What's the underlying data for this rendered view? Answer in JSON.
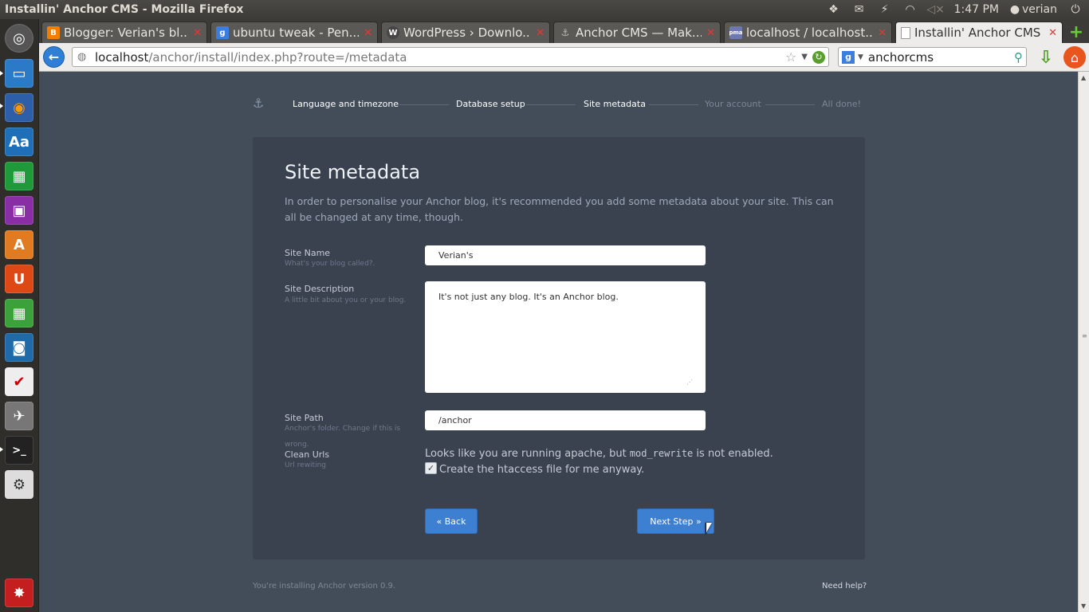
{
  "system": {
    "window_title": "Installin' Anchor CMS - Mozilla Firefox",
    "clock": "1:47 PM",
    "user": "verian"
  },
  "browser": {
    "tabs": [
      {
        "label": "Blogger: Verian's bl...",
        "icon": "blogger-icon",
        "color": "#f57d00"
      },
      {
        "label": "ubuntu tweak - Pen...",
        "icon": "google-icon",
        "color": "#3b7ee0"
      },
      {
        "label": "WordPress › Downlo...",
        "icon": "wordpress-icon",
        "color": "#464646"
      },
      {
        "label": "Anchor CMS — Mak...",
        "icon": "anchor-icon",
        "color": "#5a5955"
      },
      {
        "label": "localhost / localhost...",
        "icon": "phpmyadmin-icon",
        "color": "#6c78af"
      },
      {
        "label": "Installin' Anchor CMS",
        "icon": "blank-page-icon",
        "color": "#ffffff",
        "active": true
      }
    ],
    "url_host": "localhost",
    "url_path": "/anchor/install/index.php?route=/metadata",
    "search_value": "anchorcms"
  },
  "installer": {
    "steps": [
      {
        "label": "Language and timezone",
        "done": true
      },
      {
        "label": "Database setup",
        "done": true
      },
      {
        "label": "Site metadata",
        "done": true
      },
      {
        "label": "Your account",
        "done": false
      },
      {
        "label": "All done!",
        "done": false
      }
    ],
    "heading": "Site metadata",
    "intro": "In order to personalise your Anchor blog, it's recommended you add some metadata about your site. This can all be changed at any time, though.",
    "site_name": {
      "label": "Site Name",
      "hint": "What's your blog called?.",
      "value": "Verian's"
    },
    "site_description": {
      "label": "Site Description",
      "hint": "A little bit about you or your blog.",
      "value": "It's not just any blog. It's an Anchor blog."
    },
    "site_path": {
      "label": "Site Path",
      "hint": "Anchor's folder. Change if this is wrong.",
      "value": "/anchor"
    },
    "clean_urls": {
      "label": "Clean Urls",
      "hint": "Url rewiting",
      "note_before": "Looks like you are running apache, but ",
      "note_code": "mod_rewrite",
      "note_after": " is not enabled.",
      "checkbox_label": "Create the htaccess file for me anyway.",
      "checked": true
    },
    "back_label": "« Back",
    "next_label": "Next Step »",
    "footer_version": "You're installing Anchor version 0.9.",
    "footer_help": "Need help?"
  }
}
